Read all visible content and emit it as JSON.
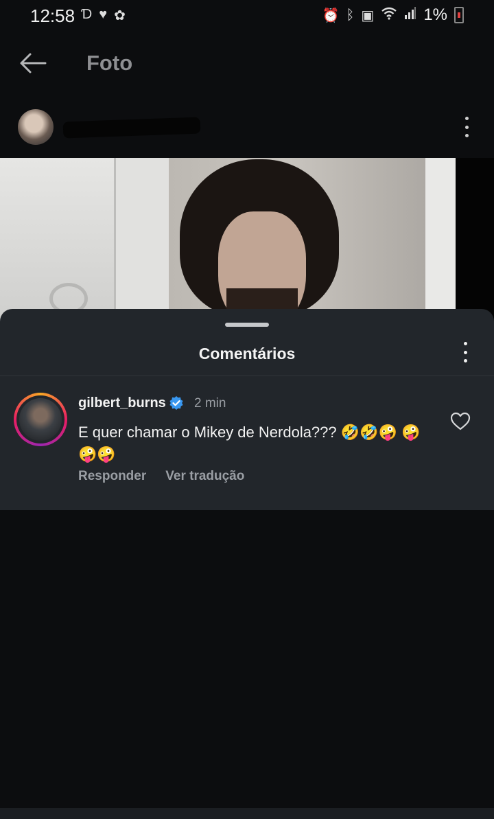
{
  "status_bar": {
    "time": "12:58",
    "battery": "1%",
    "left_icons": [
      "disney-icon",
      "heart-icon",
      "flower-icon"
    ],
    "right_icons": [
      "alarm-icon",
      "bluetooth-icon",
      "battery-saver-icon",
      "wifi-icon",
      "signal-icon",
      "battery-icon"
    ]
  },
  "header": {
    "title": "Foto",
    "back_icon": "arrow-left-icon"
  },
  "post": {
    "more_icon": "more-vertical-icon"
  },
  "comments_sheet": {
    "title": "Comentários",
    "more_icon": "more-vertical-icon",
    "comments": [
      {
        "username": "gilbert_burns",
        "verified": true,
        "time": "2 min",
        "text": "E quer chamar o Mikey de Nerdola??? 🤣🤣🤪 🤪🤪🤪",
        "reply_label": "Responder",
        "translate_label": "Ver tradução",
        "like_icon": "heart-outline-icon"
      }
    ]
  },
  "colors": {
    "background": "#0c0d0f",
    "sheet": "#22262b",
    "verified_blue": "#3897f0",
    "secondary_text": "#9a9ea4"
  }
}
